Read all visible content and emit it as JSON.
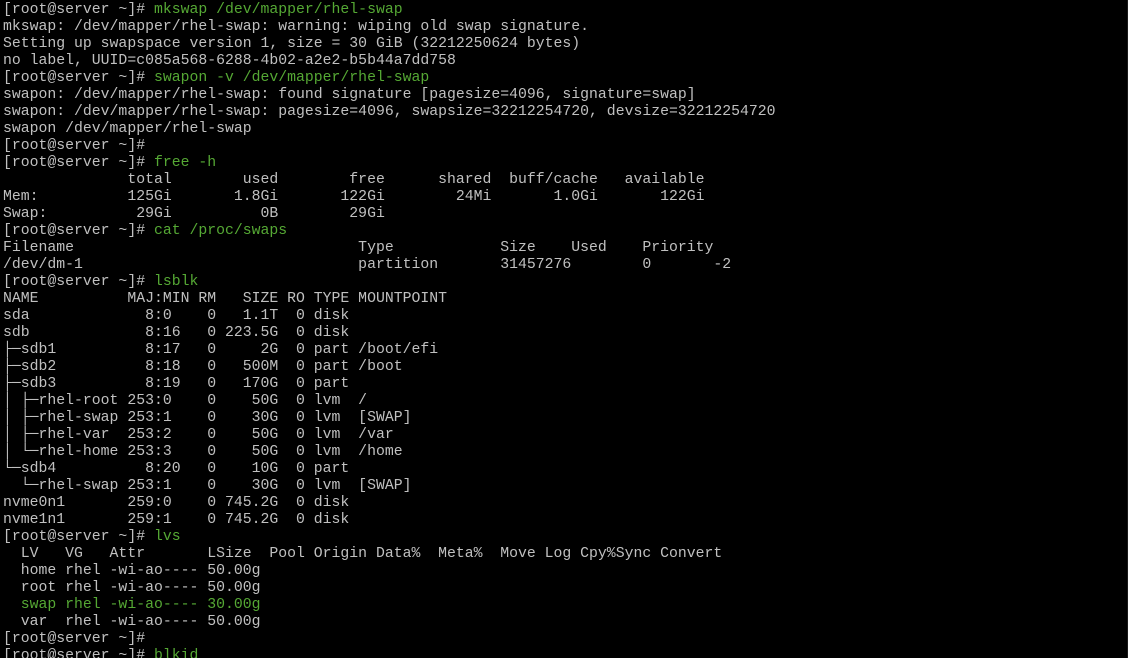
{
  "terminal": {
    "colors": {
      "background": "#000000",
      "foreground": "#c0c0c0",
      "command": "#55a834"
    },
    "lines": [
      {
        "kind": "cmd",
        "prompt": "[root@server ~]# ",
        "text": "mkswap /dev/mapper/rhel-swap"
      },
      {
        "kind": "out",
        "text": "mkswap: /dev/mapper/rhel-swap: warning: wiping old swap signature."
      },
      {
        "kind": "out",
        "text": "Setting up swapspace version 1, size = 30 GiB (32212250624 bytes)"
      },
      {
        "kind": "out",
        "text": "no label, UUID=c085a568-6288-4b02-a2e2-b5b44a7dd758"
      },
      {
        "kind": "cmd",
        "prompt": "[root@server ~]# ",
        "text": "swapon -v /dev/mapper/rhel-swap"
      },
      {
        "kind": "out",
        "text": "swapon: /dev/mapper/rhel-swap: found signature [pagesize=4096, signature=swap]"
      },
      {
        "kind": "out",
        "text": "swapon: /dev/mapper/rhel-swap: pagesize=4096, swapsize=32212254720, devsize=32212254720"
      },
      {
        "kind": "out",
        "text": "swapon /dev/mapper/rhel-swap"
      },
      {
        "kind": "cmd",
        "prompt": "[root@server ~]# ",
        "text": ""
      },
      {
        "kind": "cmd",
        "prompt": "[root@server ~]# ",
        "text": "free -h"
      },
      {
        "kind": "out",
        "text": "              total        used        free      shared  buff/cache   available"
      },
      {
        "kind": "out",
        "text": "Mem:          125Gi       1.8Gi       122Gi        24Mi       1.0Gi       122Gi"
      },
      {
        "kind": "out",
        "text": "Swap:          29Gi          0B        29Gi"
      },
      {
        "kind": "cmd",
        "prompt": "[root@server ~]# ",
        "text": "cat /proc/swaps"
      },
      {
        "kind": "out",
        "text": "Filename                                Type            Size    Used    Priority"
      },
      {
        "kind": "out",
        "text": "/dev/dm-1                               partition       31457276        0       -2"
      },
      {
        "kind": "cmd",
        "prompt": "[root@server ~]# ",
        "text": "lsblk"
      },
      {
        "kind": "out",
        "text": "NAME          MAJ:MIN RM   SIZE RO TYPE MOUNTPOINT"
      },
      {
        "kind": "out",
        "text": "sda             8:0    0   1.1T  0 disk"
      },
      {
        "kind": "out",
        "text": "sdb             8:16   0 223.5G  0 disk"
      },
      {
        "kind": "out",
        "text": "├─sdb1          8:17   0     2G  0 part /boot/efi"
      },
      {
        "kind": "out",
        "text": "├─sdb2          8:18   0   500M  0 part /boot"
      },
      {
        "kind": "out",
        "text": "├─sdb3          8:19   0   170G  0 part"
      },
      {
        "kind": "out",
        "text": "│ ├─rhel-root 253:0    0    50G  0 lvm  /"
      },
      {
        "kind": "out",
        "text": "│ ├─rhel-swap 253:1    0    30G  0 lvm  [SWAP]"
      },
      {
        "kind": "out",
        "text": "│ ├─rhel-var  253:2    0    50G  0 lvm  /var"
      },
      {
        "kind": "out",
        "text": "│ └─rhel-home 253:3    0    50G  0 lvm  /home"
      },
      {
        "kind": "out",
        "text": "└─sdb4          8:20   0    10G  0 part"
      },
      {
        "kind": "out",
        "text": "  └─rhel-swap 253:1    0    30G  0 lvm  [SWAP]"
      },
      {
        "kind": "out",
        "text": "nvme0n1       259:0    0 745.2G  0 disk"
      },
      {
        "kind": "out",
        "text": "nvme1n1       259:1    0 745.2G  0 disk"
      },
      {
        "kind": "cmd",
        "prompt": "[root@server ~]# ",
        "text": "lvs"
      },
      {
        "kind": "out",
        "text": "  LV   VG   Attr       LSize  Pool Origin Data%  Meta%  Move Log Cpy%Sync Convert"
      },
      {
        "kind": "out",
        "text": "  home rhel -wi-ao---- 50.00g"
      },
      {
        "kind": "out",
        "text": "  root rhel -wi-ao---- 50.00g"
      },
      {
        "kind": "green",
        "text": "  swap rhel -wi-ao---- 30.00g"
      },
      {
        "kind": "out",
        "text": "  var  rhel -wi-ao---- 50.00g"
      },
      {
        "kind": "cmd",
        "prompt": "[root@server ~]# ",
        "text": ""
      },
      {
        "kind": "cmd",
        "prompt": "[root@server ~]# ",
        "text": "blkid"
      }
    ]
  }
}
